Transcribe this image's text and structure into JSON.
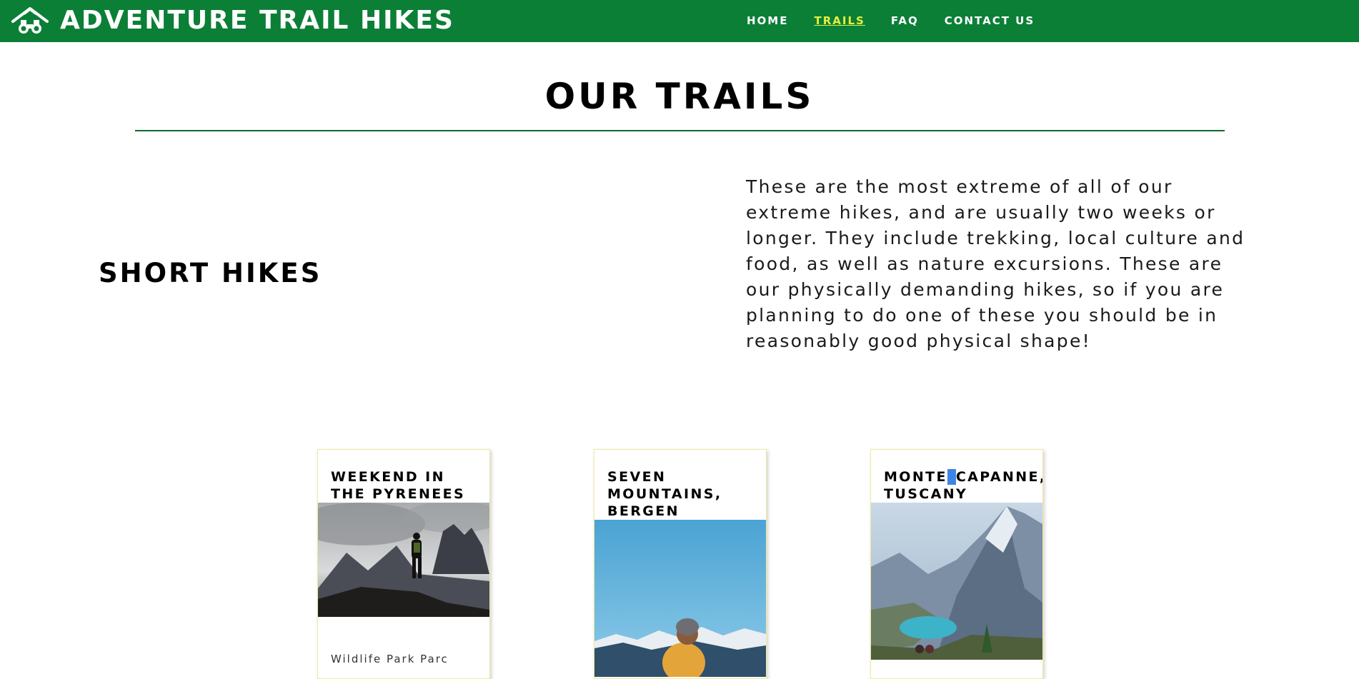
{
  "header": {
    "site_title": "ADVENTURE TRAIL HIKES",
    "logo_icon": "mountain-binoculars-icon",
    "brand_color": "#0b7f36",
    "active_link_color": "#e6f03c",
    "nav": [
      {
        "label": "HOME",
        "active": false
      },
      {
        "label": "TRAILS",
        "active": true
      },
      {
        "label": "FAQ",
        "active": false
      },
      {
        "label": "CONTACT US",
        "active": false
      }
    ]
  },
  "main": {
    "page_title": "OUR TRAILS",
    "section": {
      "heading": "SHORT HIKES",
      "description": "These are the most extreme of all of our extreme hikes, and are usually two weeks or longer. They include trekking, local culture and food, as well as nature excursions. These are our physically demanding hikes, so if you are planning to do one of these you should be in reasonably good physical shape!"
    },
    "cards": [
      {
        "title": "WEEKEND IN THE PYRENEES",
        "image": "hiker-on-cloudy-peak-photo",
        "text": "Wildlife Park Parc"
      },
      {
        "title": "SEVEN MOUNTAINS, BERGEN",
        "image": "hiker-with-beanie-sky-photo"
      },
      {
        "title_part1": "MONTE",
        "title_part2": "CAPANNE,",
        "title_part3": "TUSCANY",
        "image": "mountain-lake-valley-photo"
      }
    ]
  }
}
